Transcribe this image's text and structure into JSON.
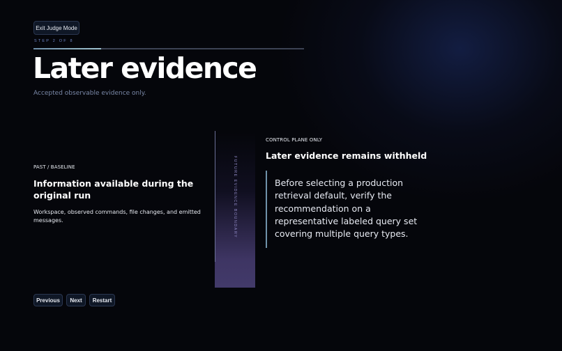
{
  "toolbar": {
    "exit_label": "Exit Judge Mode"
  },
  "progress": {
    "step_label": "STEP 2 OF 8",
    "current": 2,
    "total": 8
  },
  "header": {
    "title": "Later evidence",
    "subtitle": "Accepted observable evidence only."
  },
  "past": {
    "tag": "PAST / BASELINE",
    "heading": "Information available during the original run",
    "body": "Workspace, observed commands, file changes, and emitted messages."
  },
  "boundary": {
    "label": "FUTURE EVIDENCE BOUNDARY"
  },
  "control": {
    "tag": "CONTROL PLANE ONLY",
    "heading": "Later evidence remains withheld",
    "quote": "Before selecting a production retrieval default, verify the recommendation on a representative labeled query set covering multiple query types."
  },
  "nav": {
    "previous_label": "Previous",
    "next_label": "Next",
    "restart_label": "Restart"
  }
}
